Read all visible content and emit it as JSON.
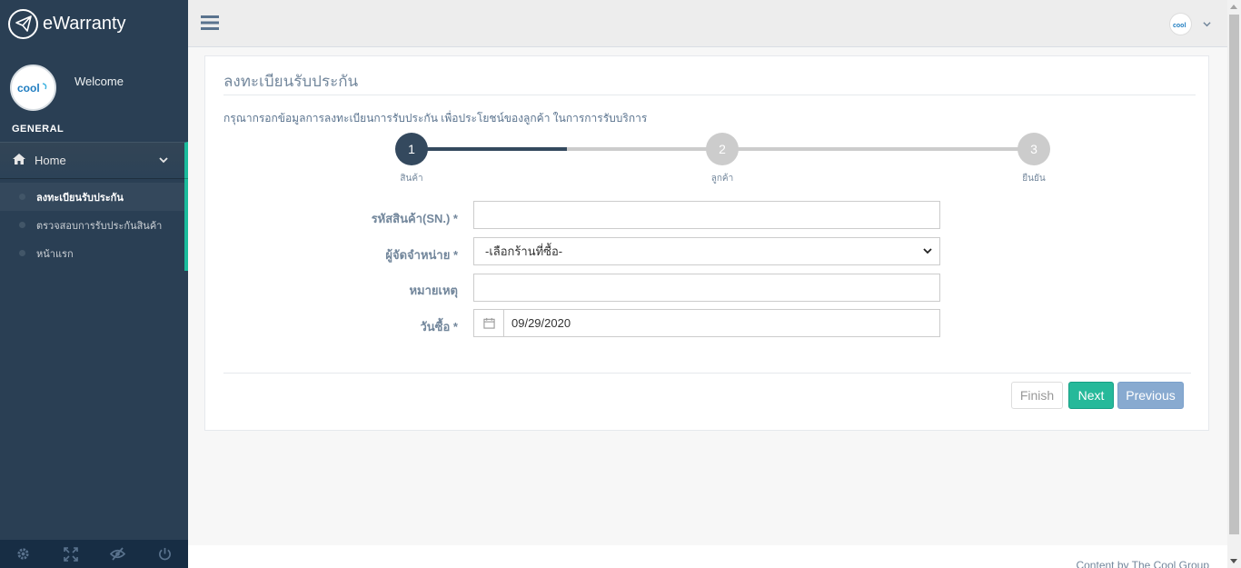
{
  "sidebar": {
    "brand": "eWarranty",
    "logo_text": "cool",
    "welcome": "Welcome",
    "section": "GENERAL",
    "home_label": "Home",
    "items": [
      {
        "label": "ลงทะเบียนรับประกัน"
      },
      {
        "label": "ตรวจสอบการรับประกันสินค้า"
      },
      {
        "label": "หน้าแรก"
      }
    ],
    "footer_icons": [
      "gear-icon",
      "fullscreen-icon",
      "eye-slash-icon",
      "power-icon"
    ]
  },
  "topnav": {
    "menu_icon": "hamburger-icon",
    "user_logo_text": "cool"
  },
  "panel": {
    "title": "ลงทะเบียนรับประกัน",
    "intro": "กรุณากรอกข้อมูลการลงทะเบียนการรับประกัน เพื่อประโยชน์ของลูกค้า ในการการรับบริการ"
  },
  "wizard": {
    "steps": [
      {
        "number": "1",
        "label": "สินค้า",
        "state": "active"
      },
      {
        "number": "2",
        "label": "ลูกค้า",
        "state": "pending"
      },
      {
        "number": "3",
        "label": "ยืนยัน",
        "state": "pending"
      }
    ],
    "progress_step": 1
  },
  "form": {
    "sn_label": "รหัสสินค้า(SN.) *",
    "sn_value": "",
    "dealer_label": "ผู้จัดจำหน่าย *",
    "dealer_selected": "-เลือกร้านที่ซื้อ-",
    "note_label": "หมายเหตุ",
    "note_value": "",
    "date_label": "วันซื้อ *",
    "date_value": "09/29/2020"
  },
  "buttons": {
    "finish": "Finish",
    "next": "Next",
    "previous": "Previous"
  },
  "footer": {
    "text": "Content by The Cool Group"
  },
  "colors": {
    "sidebar": "#2A3F54",
    "accent": "#1ABB9C",
    "next_button": "#26B99A",
    "previous_button": "#88AAD0",
    "wizard_active": "#34495E"
  }
}
